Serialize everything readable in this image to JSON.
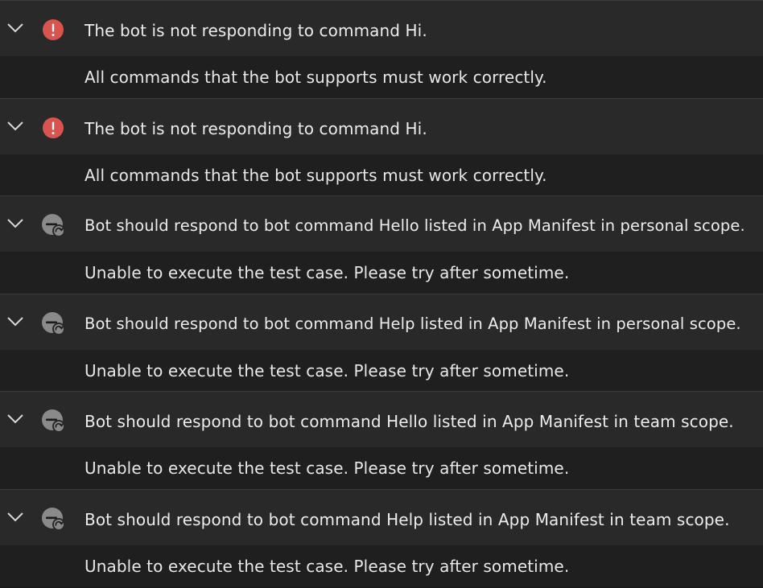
{
  "results": [
    {
      "status": "error",
      "status_icon": "error-icon",
      "title": "The bot is not responding to command Hi.",
      "detail": "All commands that the bot supports must work correctly."
    },
    {
      "status": "error",
      "status_icon": "error-icon",
      "title": "The bot is not responding to command Hi.",
      "detail": "All commands that the bot supports must work correctly."
    },
    {
      "status": "skipped",
      "status_icon": "skipped-icon",
      "title": "Bot should respond to bot command Hello listed in App Manifest in personal scope.",
      "detail": "Unable to execute the test case. Please try after sometime."
    },
    {
      "status": "skipped",
      "status_icon": "skipped-icon",
      "title": "Bot should respond to bot command Help listed in App Manifest in personal scope.",
      "detail": "Unable to execute the test case. Please try after sometime."
    },
    {
      "status": "skipped",
      "status_icon": "skipped-icon",
      "title": "Bot should respond to bot command Hello listed in App Manifest in team scope.",
      "detail": "Unable to execute the test case. Please try after sometime."
    },
    {
      "status": "skipped",
      "status_icon": "skipped-icon",
      "title": "Bot should respond to bot command Help listed in App Manifest in team scope.",
      "detail": "Unable to execute the test case. Please try after sometime."
    }
  ],
  "colors": {
    "error": "#d9534f",
    "skipped": "#8a8a8a",
    "header_bg": "#292929",
    "detail_bg": "#1f1f1f"
  }
}
